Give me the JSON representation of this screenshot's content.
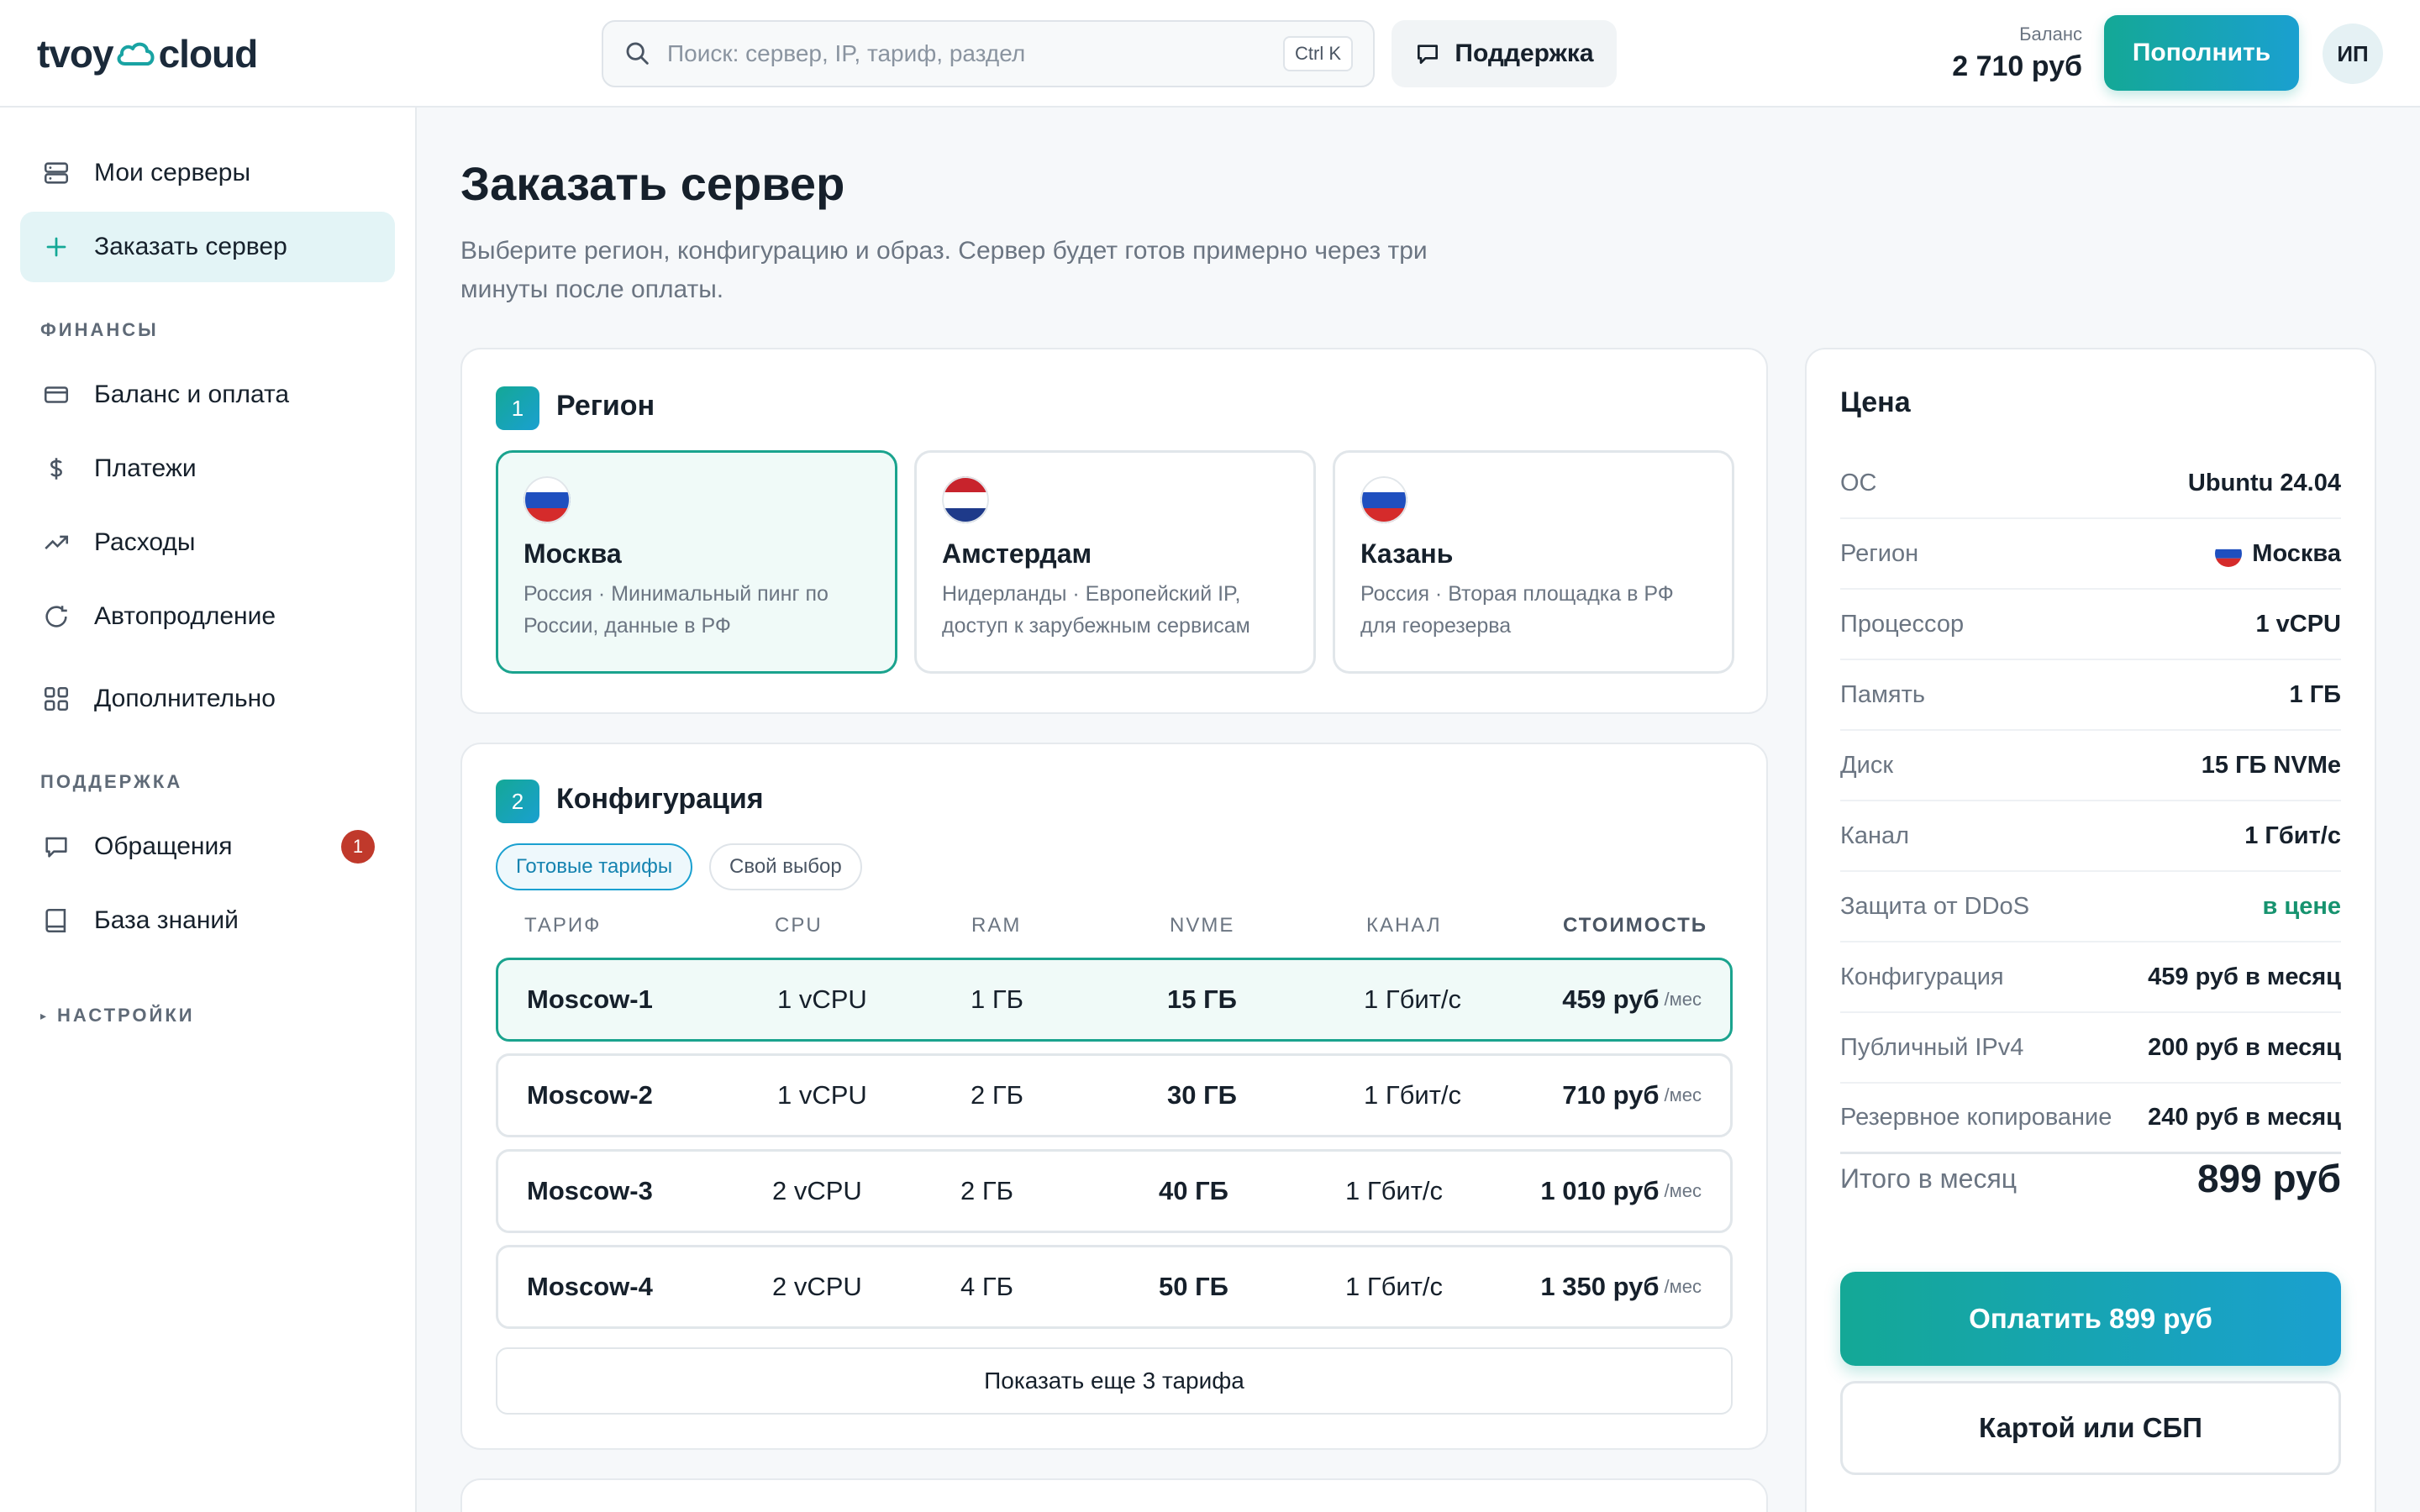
{
  "header": {
    "logo_left": "tvoy",
    "logo_right": "cloud",
    "search_placeholder": "Поиск: сервер, IP, тариф, раздел",
    "search_shortcut": "Ctrl K",
    "support_label": "Поддержка",
    "balance_label": "Баланс",
    "balance_value": "2 710 руб",
    "topup_label": "Пополнить",
    "avatar_initials": "ИП"
  },
  "sidebar": {
    "items": [
      {
        "label": "Мои серверы",
        "icon": "server-icon"
      },
      {
        "label": "Заказать сервер",
        "icon": "plus-icon",
        "active": true
      }
    ],
    "finance_section": "ФИНАНСЫ",
    "finance_items": [
      {
        "label": "Баланс и оплата",
        "icon": "card-icon"
      },
      {
        "label": "Платежи",
        "icon": "dollar-icon"
      },
      {
        "label": "Расходы",
        "icon": "trend-icon"
      },
      {
        "label": "Автопродление",
        "icon": "refresh-icon"
      },
      {
        "label": "Дополнительно",
        "icon": "grid-icon"
      }
    ],
    "support_section": "ПОДДЕРЖКА",
    "support_items": [
      {
        "label": "Обращения",
        "icon": "chat-icon",
        "badge": "1"
      },
      {
        "label": "База знаний",
        "icon": "book-icon"
      }
    ],
    "settings_section": "НАСТРОЙКИ"
  },
  "main": {
    "title": "Заказать сервер",
    "subtitle": "Выберите регион, конфигурацию и образ. Сервер будет готов примерно через три минуты после оплаты.",
    "region": {
      "step": "1",
      "title": "Регион",
      "options": [
        {
          "name": "Москва",
          "desc": "Россия · Минимальный пинг по России, данные в РФ",
          "flag": "ru",
          "selected": true
        },
        {
          "name": "Амстердам",
          "desc": "Нидерланды · Европейский IP, доступ к зарубежным сервисам",
          "flag": "nl"
        },
        {
          "name": "Казань",
          "desc": "Россия · Вторая площадка в РФ для георезерва",
          "flag": "ru"
        }
      ]
    },
    "config": {
      "step": "2",
      "title": "Конфигурация",
      "tabs": [
        "Готовые тарифы",
        "Свой выбор"
      ],
      "columns": [
        "ТАРИФ",
        "CPU",
        "RAM",
        "NVME",
        "КАНАЛ",
        "СТОИМОСТЬ"
      ],
      "rows": [
        {
          "name": "Moscow-1",
          "cpu": "1 vCPU",
          "ram": "1 ГБ",
          "nvme": "15 ГБ",
          "channel": "1 Гбит/с",
          "price": "459 руб",
          "per": "/мес",
          "selected": true
        },
        {
          "name": "Moscow-2",
          "cpu": "1 vCPU",
          "ram": "2 ГБ",
          "nvme": "30 ГБ",
          "channel": "1 Гбит/с",
          "price": "710 руб",
          "per": "/мес"
        },
        {
          "name": "Moscow-3",
          "cpu": "2 vCPU",
          "ram": "2 ГБ",
          "nvme": "40 ГБ",
          "channel": "1 Гбит/с",
          "price": "1 010 руб",
          "per": "/мес"
        },
        {
          "name": "Moscow-4",
          "cpu": "2 vCPU",
          "ram": "4 ГБ",
          "nvme": "50 ГБ",
          "channel": "1 Гбит/с",
          "price": "1 350 руб",
          "per": "/мес"
        }
      ],
      "more_label": "Показать еще 3 тарифа"
    }
  },
  "price": {
    "title": "Цена",
    "rows": [
      {
        "k": "ОС",
        "v": "Ubuntu 24.04"
      },
      {
        "k": "Регион",
        "v": "Москва",
        "flag": "ru"
      },
      {
        "k": "Процессор",
        "v": "1 vCPU"
      },
      {
        "k": "Память",
        "v": "1 ГБ"
      },
      {
        "k": "Диск",
        "v": "15 ГБ NVMe"
      },
      {
        "k": "Канал",
        "v": "1 Гбит/с"
      },
      {
        "k": "Защита от DDoS",
        "v": "в цене",
        "green": true
      },
      {
        "k": "Конфигурация",
        "v": "459 руб в месяц"
      },
      {
        "k": "Публичный IPv4",
        "v": "200 руб в месяц"
      },
      {
        "k": "Резервное копирование",
        "v": "240 руб в месяц"
      }
    ],
    "total_label": "Итого в месяц",
    "total_value": "899 руб",
    "pay_label": "Оплатить 899 руб",
    "alt_pay_label": "Картой или СБП"
  },
  "colors": {
    "accent": "#14a896",
    "accent2": "#1aa0d0",
    "badge": "#c0392b",
    "green_text": "#16936f"
  }
}
